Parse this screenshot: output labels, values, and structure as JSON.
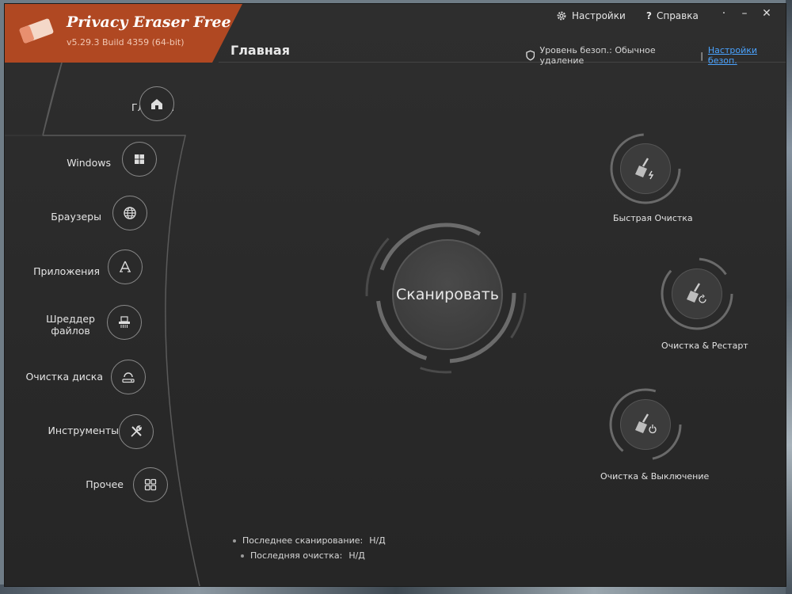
{
  "app": {
    "title": "Privacy Eraser Free",
    "version": "v5.29.3 Build 4359 (64-bit)"
  },
  "header": {
    "settings_label": "Настройки",
    "help_label": "Справка",
    "page_title": "Главная",
    "security_level_label": "Уровень безоп.: Обычное удаление",
    "separator": "|",
    "security_settings_link": "Настройки безоп."
  },
  "sidebar": {
    "items": [
      {
        "label": "Главная",
        "icon": "home-icon"
      },
      {
        "label": "Windows",
        "icon": "windows-icon"
      },
      {
        "label": "Браузеры",
        "icon": "globe-icon"
      },
      {
        "label": "Приложения",
        "icon": "apps-icon"
      },
      {
        "label": "Шреддер\nфайлов",
        "icon": "shredder-icon"
      },
      {
        "label": "Очистка диска",
        "icon": "disk-clean-icon"
      },
      {
        "label": "Инструменты",
        "icon": "tools-icon"
      },
      {
        "label": "Прочее",
        "icon": "grid-icon"
      }
    ]
  },
  "main": {
    "scan_label": "Сканировать",
    "actions": [
      {
        "label": "Быстрая Очистка",
        "icon": "broom-lightning-icon"
      },
      {
        "label": "Очистка & Рестарт",
        "icon": "broom-restart-icon"
      },
      {
        "label": "Очистка & Выключение",
        "icon": "broom-power-icon"
      }
    ],
    "last_scan_label": "Последнее сканирование:",
    "last_scan_value": "Н/Д",
    "last_clean_label": "Последняя очистка:",
    "last_clean_value": "Н/Д"
  },
  "colors": {
    "accent": "#b04822",
    "link": "#4aa3ff",
    "background": "#2b2b2b"
  }
}
